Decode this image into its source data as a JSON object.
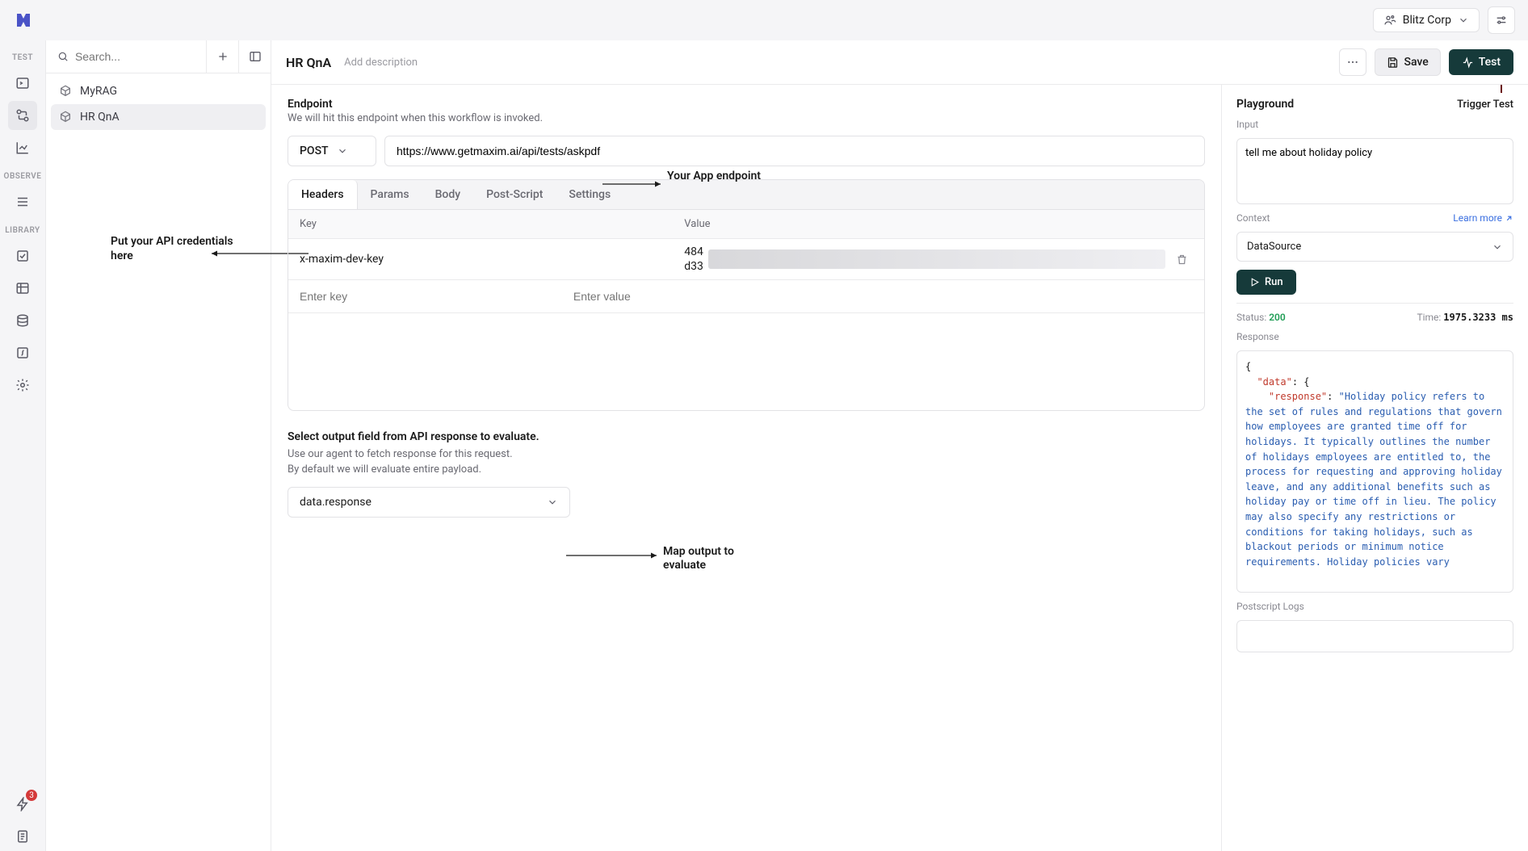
{
  "org": {
    "name": "Blitz Corp"
  },
  "sidebar": {
    "sections": {
      "test": "TEST",
      "observe": "OBSERVE",
      "library": "LIBRARY"
    },
    "badge": "3"
  },
  "search": {
    "placeholder": "Search..."
  },
  "projects": {
    "items": [
      {
        "label": "MyRAG"
      },
      {
        "label": "HR QnA"
      }
    ]
  },
  "page": {
    "title": "HR QnA",
    "add_description": "Add description",
    "save": "Save",
    "test": "Test"
  },
  "endpoint": {
    "title": "Endpoint",
    "subtitle": "We will hit this endpoint when this workflow is invoked.",
    "method": "POST",
    "url": "https://www.getmaxim.ai/api/tests/askpdf",
    "tabs": {
      "headers": "Headers",
      "params": "Params",
      "body": "Body",
      "postscript": "Post-Script",
      "settings": "Settings"
    },
    "kv_header": {
      "key": "Key",
      "value": "Value"
    },
    "headers_rows": [
      {
        "key": "x-maxim-dev-key",
        "value_prefix": "484",
        "value_line2": "d33"
      }
    ],
    "placeholder_key": "Enter key",
    "placeholder_value": "Enter value"
  },
  "output": {
    "title": "Select output field from API response to evaluate.",
    "sub1": "Use our agent to fetch response for this request.",
    "sub2": "By default we will evaluate entire payload.",
    "selected": "data.response"
  },
  "playground": {
    "title": "Playground",
    "trigger": "Trigger Test",
    "input_label": "Input",
    "input_value": "tell me about holiday policy",
    "context_label": "Context",
    "learn_more": "Learn more",
    "context_selected": "DataSource",
    "run": "Run",
    "status_label": "Status:",
    "status_code": "200",
    "time_label": "Time:",
    "time_value": "1975.3233 ms",
    "response_label": "Response",
    "response_key_data": "\"data\"",
    "response_key_response": "\"response\"",
    "response_text": "\"Holiday policy refers to the set of rules and regulations that govern how employees are granted time off for holidays. It typically outlines the number of holidays employees are entitled to, the process for requesting and approving holiday leave, and any additional benefits such as holiday pay or time off in lieu. The policy may also specify any restrictions or conditions for taking holidays, such as blackout periods or minimum notice requirements. Holiday policies vary",
    "ps_logs": "Postscript Logs"
  },
  "annotations": {
    "api_creds": "Put your API credentials here",
    "app_endpoint": "Your App endpoint",
    "map_output": "Map output to evaluate"
  }
}
